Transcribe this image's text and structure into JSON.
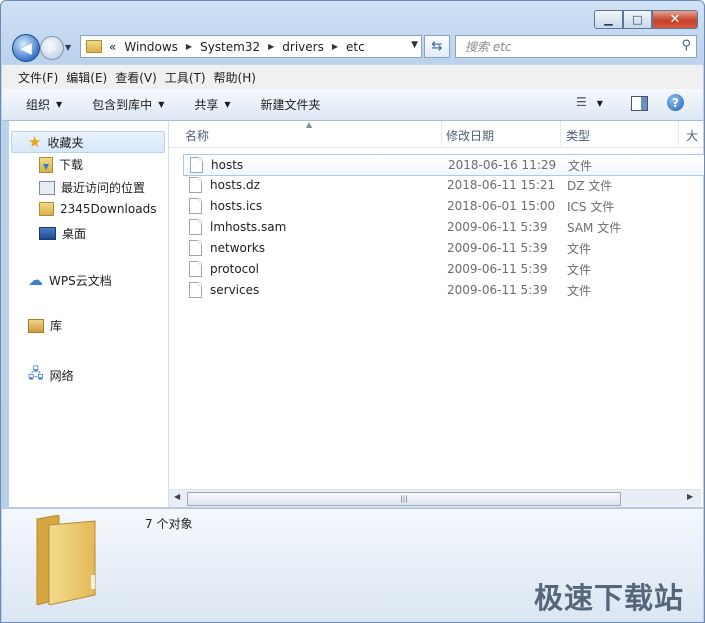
{
  "window": {
    "min": "▁",
    "max": "□",
    "close": "✕"
  },
  "nav": {
    "back": "◀",
    "forward": "▶"
  },
  "address": {
    "overflow": "«",
    "crumbs": [
      "Windows",
      "System32",
      "drivers",
      "etc"
    ]
  },
  "search": {
    "placeholder": "搜索 etc"
  },
  "menu": [
    "文件(F)",
    "编辑(E)",
    "查看(V)",
    "工具(T)",
    "帮助(H)"
  ],
  "toolbar": [
    "组织",
    "包含到库中",
    "共享",
    "新建文件夹"
  ],
  "navpane": {
    "favorites": "收藏夹",
    "fav_items": [
      "下载",
      "最近访问的位置",
      "2345Downloads",
      "桌面"
    ],
    "wps": "WPS云文档",
    "library": "库",
    "network": "网络"
  },
  "columns": {
    "name": "名称",
    "date": "修改日期",
    "type": "类型",
    "size": "大"
  },
  "files": [
    {
      "name": "hosts",
      "date": "2018-06-16 11:29",
      "type": "文件"
    },
    {
      "name": "hosts.dz",
      "date": "2018-06-11 15:21",
      "type": "DZ 文件"
    },
    {
      "name": "hosts.ics",
      "date": "2018-06-01 15:00",
      "type": "ICS 文件"
    },
    {
      "name": "lmhosts.sam",
      "date": "2009-06-11 5:39",
      "type": "SAM 文件"
    },
    {
      "name": "networks",
      "date": "2009-06-11 5:39",
      "type": "文件"
    },
    {
      "name": "protocol",
      "date": "2009-06-11 5:39",
      "type": "文件"
    },
    {
      "name": "services",
      "date": "2009-06-11 5:39",
      "type": "文件"
    }
  ],
  "details": {
    "count": "7 个对象"
  },
  "watermark": "极速下载站"
}
